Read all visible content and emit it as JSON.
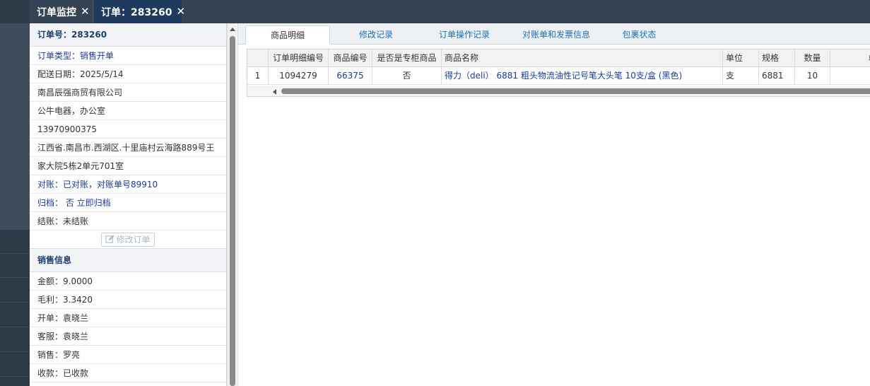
{
  "top_tabs": [
    {
      "label": "订单监控"
    },
    {
      "label": "订单：283260"
    }
  ],
  "order_info": {
    "order_no": "订单号：283260",
    "order_type": "订单类型：销售开单",
    "delivery_date": "配送日期：2025/5/14",
    "company": "南昌辰强商贸有限公司",
    "contact": "公牛电器，办公室",
    "phone": "13970900375",
    "address_line1": "江西省.南昌市.西湖区.十里庙村云海路889号王",
    "address_line2": "家大院5栋2单元701室",
    "reconcile": "对账：已对账，对账单号89910",
    "archive": "归档：  否 立即归档",
    "settlement": "结账：未结账",
    "edit_button": "修改订单"
  },
  "sales_info": {
    "title": "销售信息",
    "amount": "金额：9.0000",
    "gross_profit": "毛利：3.3420",
    "creator": "开单：袁晓兰",
    "service": "客服：袁晓兰",
    "sales": "销售：罗亮",
    "payment": "收款：已收款"
  },
  "main_tabs": [
    {
      "label": "商品明细"
    },
    {
      "label": "修改记录"
    },
    {
      "label": "订单操作记录"
    },
    {
      "label": "对账单和发票信息"
    },
    {
      "label": "包裹状态"
    }
  ],
  "grid": {
    "columns": [
      "",
      "订单明细编号",
      "商品编号",
      "是否是专柜商品",
      "商品名称",
      "单位",
      "规格",
      "数量",
      "单"
    ],
    "rows": [
      [
        "1",
        "1094279",
        "66375",
        "否",
        "得力（deli） 6881 粗头物流油性记号笔大头笔 10支/盒 (黑色)",
        "支",
        "6881",
        "10",
        ""
      ]
    ]
  },
  "colors": {
    "topbar": "#344253",
    "active_tab": "#1f3a5f",
    "link_blue": "#1b3d9a",
    "tab_blue": "#1c6fb8"
  }
}
